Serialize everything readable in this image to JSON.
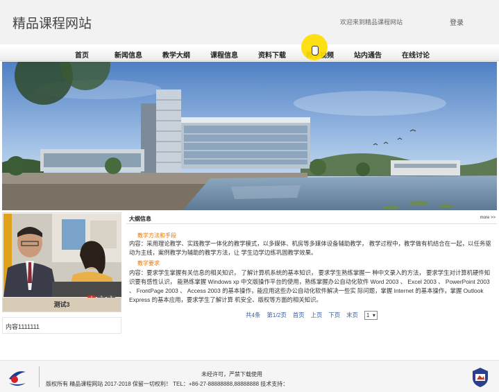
{
  "header": {
    "site_title": "精品课程网站",
    "welcome": "欢迎来到精品课程网站",
    "login": "登录"
  },
  "nav": {
    "items": [
      "首页",
      "新闻信息",
      "教学大纲",
      "课程信息",
      "资料下载",
      "教学视频",
      "站内通告",
      "在线讨论"
    ]
  },
  "card": {
    "caption": "测试3",
    "pager": [
      "1",
      "2",
      "3"
    ],
    "text": "内容1111111"
  },
  "outline": {
    "title": "大纲信息",
    "more": "more >>",
    "sub1": "教学方法和手段",
    "para1": "内容：采用理论教学、实践教学一体化的教学模式，以多媒体、机房等多媒体设备辅助教学， 教学过程中，教学做有机结合在一起，以任务驱动为主线，案例教学为辅助的教学方法，让 学生边学边练巩固教学效果。",
    "sub2": "教学要求",
    "para2": "内容：要求学生掌握有关信息的相关知识， 了解计算机系统的基本知识， 要求学生熟练掌握一 种中文录入的方法， 要求学生对计算机硬件知识要有感性认识， 能熟练掌握 Windows xp 中文版操作平台的使用，熟练掌握办公自动化软件 Word 2003 、 Excel 2003 、 PowerPoint 2003 、 FrontPage 2003 、 Access 2003 的基本操作，能应用这些办公自动化软件解决一些实 际问题，掌握 Internet 的基本操作，掌握 Outlook Express 的基本应用，要求学生了解计算 机安全、版权等方面的相关知识。"
  },
  "pagination": {
    "total": "共4条",
    "page_info": "第1/2页",
    "first": "首页",
    "prev": "上页",
    "next": "下页",
    "last": "末页",
    "selected": "1"
  },
  "footer": {
    "line1": "未经许可，严禁下载使用",
    "line2": "版权所有 精品课程网站 2017-2018 保留一切权利！ TEL：+86-27-88888888,88888888   技术支持："
  },
  "colors": {
    "accent": "#e07b10",
    "link": "#3a5fa0",
    "pager_active": "#c0392b"
  }
}
